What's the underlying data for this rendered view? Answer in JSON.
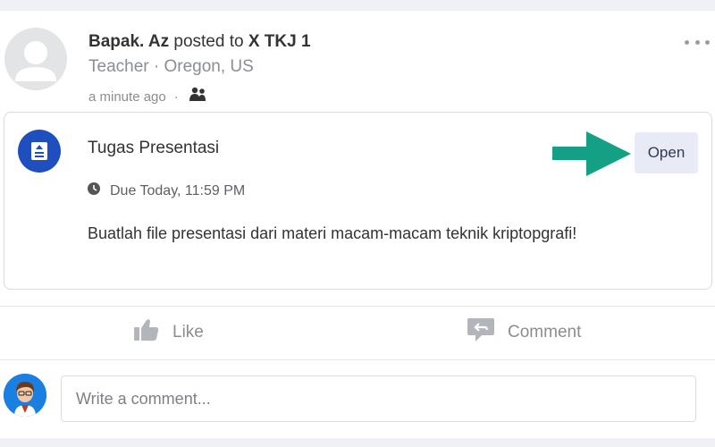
{
  "post": {
    "author": "Bapak. Az",
    "posted_to_text": "posted to",
    "class_name": "X TKJ 1",
    "role_location": "Teacher · Oregon, US",
    "time": "a minute ago",
    "separator": "·"
  },
  "assignment": {
    "title": "Tugas Presentasi",
    "due": "Due Today, 11:59 PM",
    "description": "Buatlah file presentasi dari materi macam-macam teknik kriptopgrafi!",
    "open_label": "Open"
  },
  "actions": {
    "like_label": "Like",
    "comment_label": "Comment"
  },
  "comment_box": {
    "placeholder": "Write a comment..."
  },
  "colors": {
    "accent_blue": "#1f4fbf",
    "arrow_teal": "#14a085",
    "open_bg": "#e8eaf6"
  }
}
